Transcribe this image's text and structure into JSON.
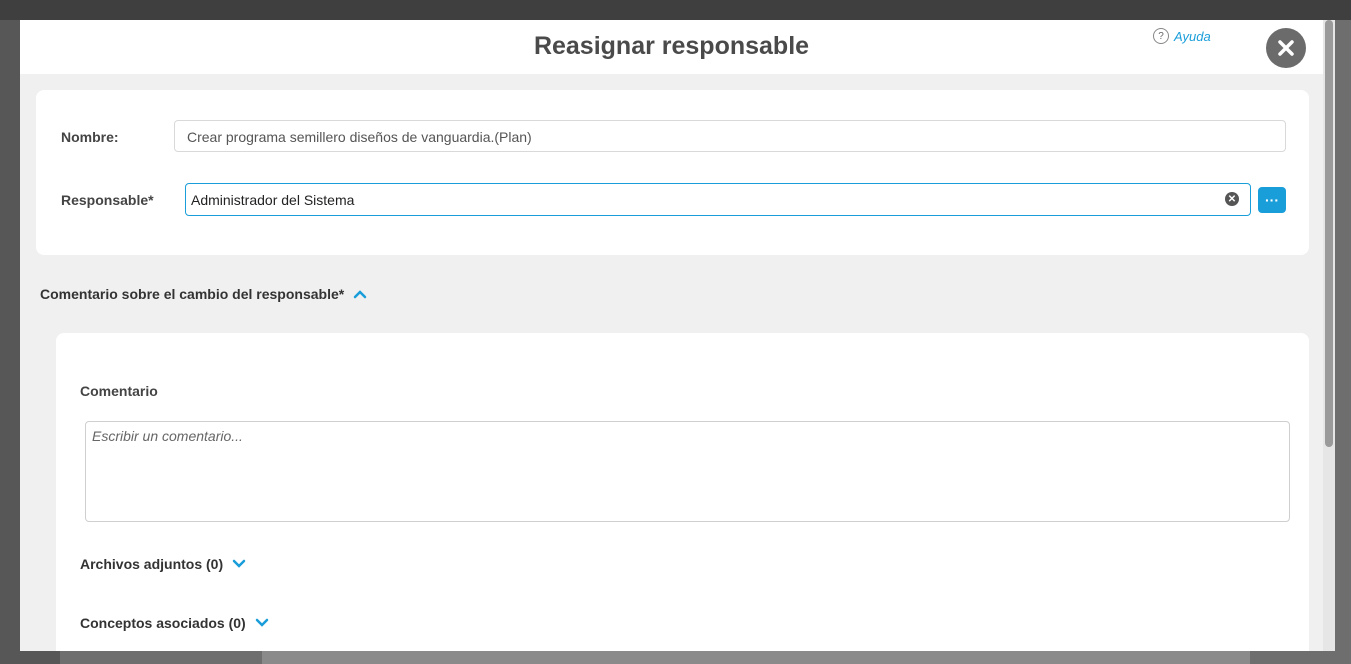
{
  "dialog": {
    "title": "Reasignar responsable",
    "help_label": "Ayuda"
  },
  "form": {
    "nombre_label": "Nombre:",
    "nombre_value": "Crear programa semillero diseños de vanguardia.(Plan)",
    "responsable_label": "Responsable*",
    "responsable_value": "Administrador del Sistema"
  },
  "comment_section": {
    "header": "Comentario sobre el cambio del responsable*",
    "label": "Comentario",
    "placeholder": "Escribir un comentario...",
    "attachments": "Archivos adjuntos (0)",
    "concepts": "Conceptos asociados (0)"
  },
  "colors": {
    "accent": "#1a9ed9",
    "title": "#4a4a4a"
  },
  "icons": {
    "help": "question-circle-icon",
    "close": "close-icon",
    "clear": "clear-x-icon",
    "more": "ellipsis-icon",
    "collapse": "chevron-up-icon",
    "expand": "chevron-down-icon"
  }
}
